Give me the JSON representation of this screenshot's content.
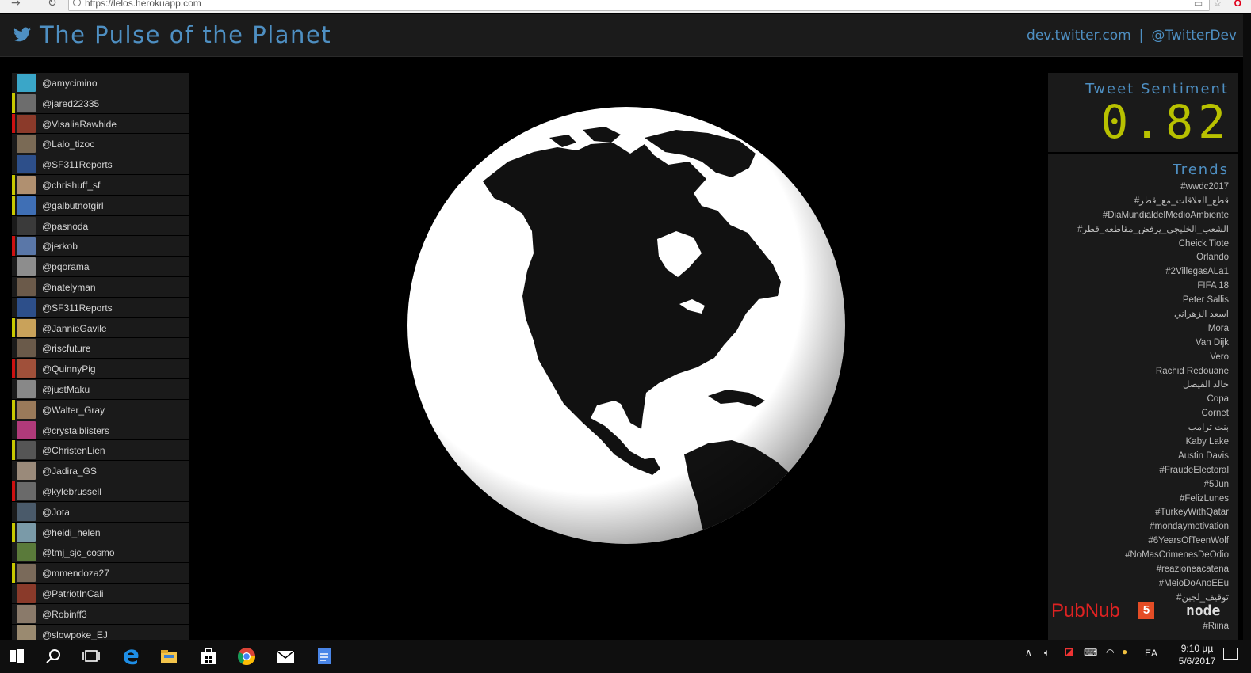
{
  "browser": {
    "url": "https://lelos.herokuapp.com"
  },
  "header": {
    "icon": "twitter-bird-icon",
    "title": "The Pulse of the Planet",
    "link_dev": "dev.twitter.com",
    "separator": "|",
    "link_handle": "@TwitterDev"
  },
  "colors": {
    "accent": "#4e8fc2",
    "sentiment_value": "#b8c100",
    "positive_marker": "#c8c800",
    "negative_marker": "#cc1111"
  },
  "users": [
    {
      "handle": "@amycimino",
      "sentiment": "neutral",
      "avatar_color": "#3aa6c8"
    },
    {
      "handle": "@jared22335",
      "sentiment": "positive",
      "avatar_color": "#6d6d6d"
    },
    {
      "handle": "@VisaliaRawhide",
      "sentiment": "negative",
      "avatar_color": "#8b3a2a"
    },
    {
      "handle": "@Lalo_tizoc",
      "sentiment": "neutral",
      "avatar_color": "#7a6a55"
    },
    {
      "handle": "@SF311Reports",
      "sentiment": "neutral",
      "avatar_color": "#2d4f8a"
    },
    {
      "handle": "@chrishuff_sf",
      "sentiment": "positive",
      "avatar_color": "#b09070"
    },
    {
      "handle": "@galbutnotgirl",
      "sentiment": "positive",
      "avatar_color": "#3f6fb5"
    },
    {
      "handle": "@pasnoda",
      "sentiment": "neutral",
      "avatar_color": "#3a3a3a"
    },
    {
      "handle": "@jerkob",
      "sentiment": "negative",
      "avatar_color": "#5a77a8"
    },
    {
      "handle": "@pqorama",
      "sentiment": "neutral",
      "avatar_color": "#8d8d8d"
    },
    {
      "handle": "@natelyman",
      "sentiment": "neutral",
      "avatar_color": "#6b5a4a"
    },
    {
      "handle": "@SF311Reports",
      "sentiment": "neutral",
      "avatar_color": "#2d4f8a"
    },
    {
      "handle": "@JannieGavile",
      "sentiment": "positive",
      "avatar_color": "#c9a25a"
    },
    {
      "handle": "@riscfuture",
      "sentiment": "neutral",
      "avatar_color": "#6a5a4a"
    },
    {
      "handle": "@QuinnyPig",
      "sentiment": "negative",
      "avatar_color": "#a0503a"
    },
    {
      "handle": "@justMaku",
      "sentiment": "neutral",
      "avatar_color": "#888888"
    },
    {
      "handle": "@Walter_Gray",
      "sentiment": "positive",
      "avatar_color": "#9a7a5a"
    },
    {
      "handle": "@crystalblisters",
      "sentiment": "neutral",
      "avatar_color": "#b03a7a"
    },
    {
      "handle": "@ChristenLien",
      "sentiment": "positive",
      "avatar_color": "#555555"
    },
    {
      "handle": "@Jadira_GS",
      "sentiment": "neutral",
      "avatar_color": "#9a8a7a"
    },
    {
      "handle": "@kylebrussell",
      "sentiment": "negative",
      "avatar_color": "#6a6a6a"
    },
    {
      "handle": "@Jota",
      "sentiment": "neutral",
      "avatar_color": "#4a5a6a"
    },
    {
      "handle": "@heidi_helen",
      "sentiment": "positive",
      "avatar_color": "#7a9aa8"
    },
    {
      "handle": "@tmj_sjc_cosmo",
      "sentiment": "neutral",
      "avatar_color": "#5a7a3a"
    },
    {
      "handle": "@mmendoza27",
      "sentiment": "positive",
      "avatar_color": "#7a6a5a"
    },
    {
      "handle": "@PatriotInCali",
      "sentiment": "neutral",
      "avatar_color": "#8a3a2a"
    },
    {
      "handle": "@Robinff3",
      "sentiment": "neutral",
      "avatar_color": "#8a7a6a"
    },
    {
      "handle": "@slowpoke_EJ",
      "sentiment": "neutral",
      "avatar_color": "#9a8a70"
    }
  ],
  "sentiment": {
    "title": "Tweet Sentiment",
    "value": "0.82"
  },
  "trends": {
    "title": "Trends",
    "items": [
      "#wwdc2017",
      "#قطع_العلاقات_مع_قطر",
      "#DiaMundialdelMedioAmbiente",
      "#الشعب_الخليجي_يرفض_مقاطعه_قطر",
      "Cheick Tiote",
      "Orlando",
      "#2VillegasALa1",
      "FIFA 18",
      "Peter Sallis",
      "اسعد الزهراني",
      "Mora",
      "Van Dijk",
      "Vero",
      "Rachid Redouane",
      "خالد الفيصل",
      "Copa",
      "Cornet",
      "بنت ترامب",
      "Kaby Lake",
      "Austin Davis",
      "#FraudeElectoral",
      "#5Jun",
      "#FelizLunes",
      "#TurkeyWithQatar",
      "#mondaymotivation",
      "#6YearsOfTeenWolf",
      "#NoMasCrimenesDeOdio",
      "#reazioneacatena",
      "#MeioDoAnoEEu",
      "#توقيف_لجين",
      "",
      "#Riina"
    ]
  },
  "logos": {
    "pubnub": "PubNub",
    "html5": "5",
    "node": "node"
  },
  "taskbar": {
    "icons": [
      "windows-start-icon",
      "search-icon",
      "task-view-icon",
      "edge-icon",
      "file-explorer-icon",
      "store-icon",
      "chrome-icon",
      "mail-icon",
      "docs-icon"
    ],
    "language": "EA",
    "time": "9:10 µµ",
    "date": "5/6/2017"
  }
}
